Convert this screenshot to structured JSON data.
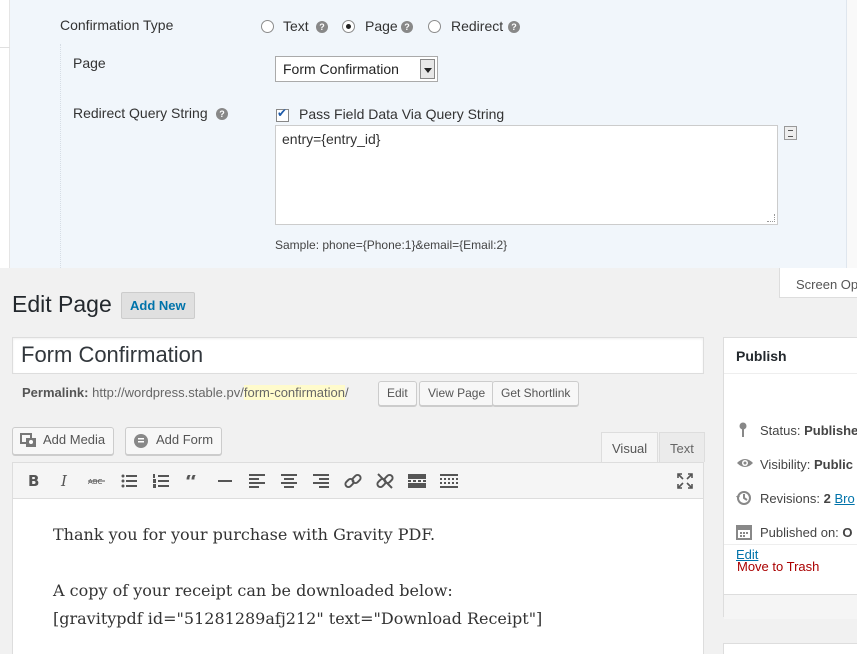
{
  "confirmation": {
    "type_label": "Confirmation Type",
    "types": [
      {
        "label": "Text",
        "selected": false
      },
      {
        "label": "Page",
        "selected": true
      },
      {
        "label": "Redirect",
        "selected": false
      }
    ],
    "help_glyph": "?",
    "page_label": "Page",
    "page_value": "Form Confirmation",
    "query_label": "Redirect Query String",
    "pass_field_label": "Pass Field Data Via Query String",
    "pass_field_checked": true,
    "query_value": "entry={entry_id}",
    "sample": "Sample: phone={Phone:1}&email={Email:2}"
  },
  "header": {
    "screen_options": "Screen Op",
    "title": "Edit Page",
    "add_new": "Add New"
  },
  "post": {
    "title": "Form Confirmation",
    "permalink_label": "Permalink:",
    "permalink_base": "http://wordpress.stable.pv/",
    "permalink_slug": "form-confirmation",
    "permalink_end": "/",
    "edit_btn": "Edit",
    "view_btn": "View Page",
    "shortlink_btn": "Get Shortlink"
  },
  "editor": {
    "add_media": "Add Media",
    "add_form": "Add Form",
    "tab_visual": "Visual",
    "tab_text": "Text",
    "toolbar": [
      "bold-icon",
      "italic-icon",
      "strikethrough-icon",
      "bullet-list-icon",
      "numbered-list-icon",
      "blockquote-icon",
      "horizontal-rule-icon",
      "align-left-icon",
      "align-center-icon",
      "align-right-icon",
      "link-icon",
      "unlink-icon",
      "read-more-icon",
      "toolbar-toggle-icon",
      "fullscreen-icon"
    ],
    "content": [
      "Thank you for your purchase with Gravity PDF.",
      "A copy of your receipt can be downloaded below:",
      "[gravitypdf id=\"51281289afj212\" text=\"Download Receipt\"]"
    ]
  },
  "publish": {
    "heading": "Publish",
    "status_label": "Status:",
    "status_value": "Publishe",
    "visibility_label": "Visibility:",
    "visibility_value": "Public",
    "revisions_label": "Revisions:",
    "revisions_value": "2",
    "revisions_link": "Bro",
    "published_label": "Published on:",
    "published_value": "O",
    "edit_link": "Edit",
    "trash": "Move to Trash"
  },
  "colors": {
    "link": "#0073aa",
    "trash": "#aa0000",
    "slug_highlight": "#fffbcc",
    "panel_bg": "#f1f6fb"
  }
}
